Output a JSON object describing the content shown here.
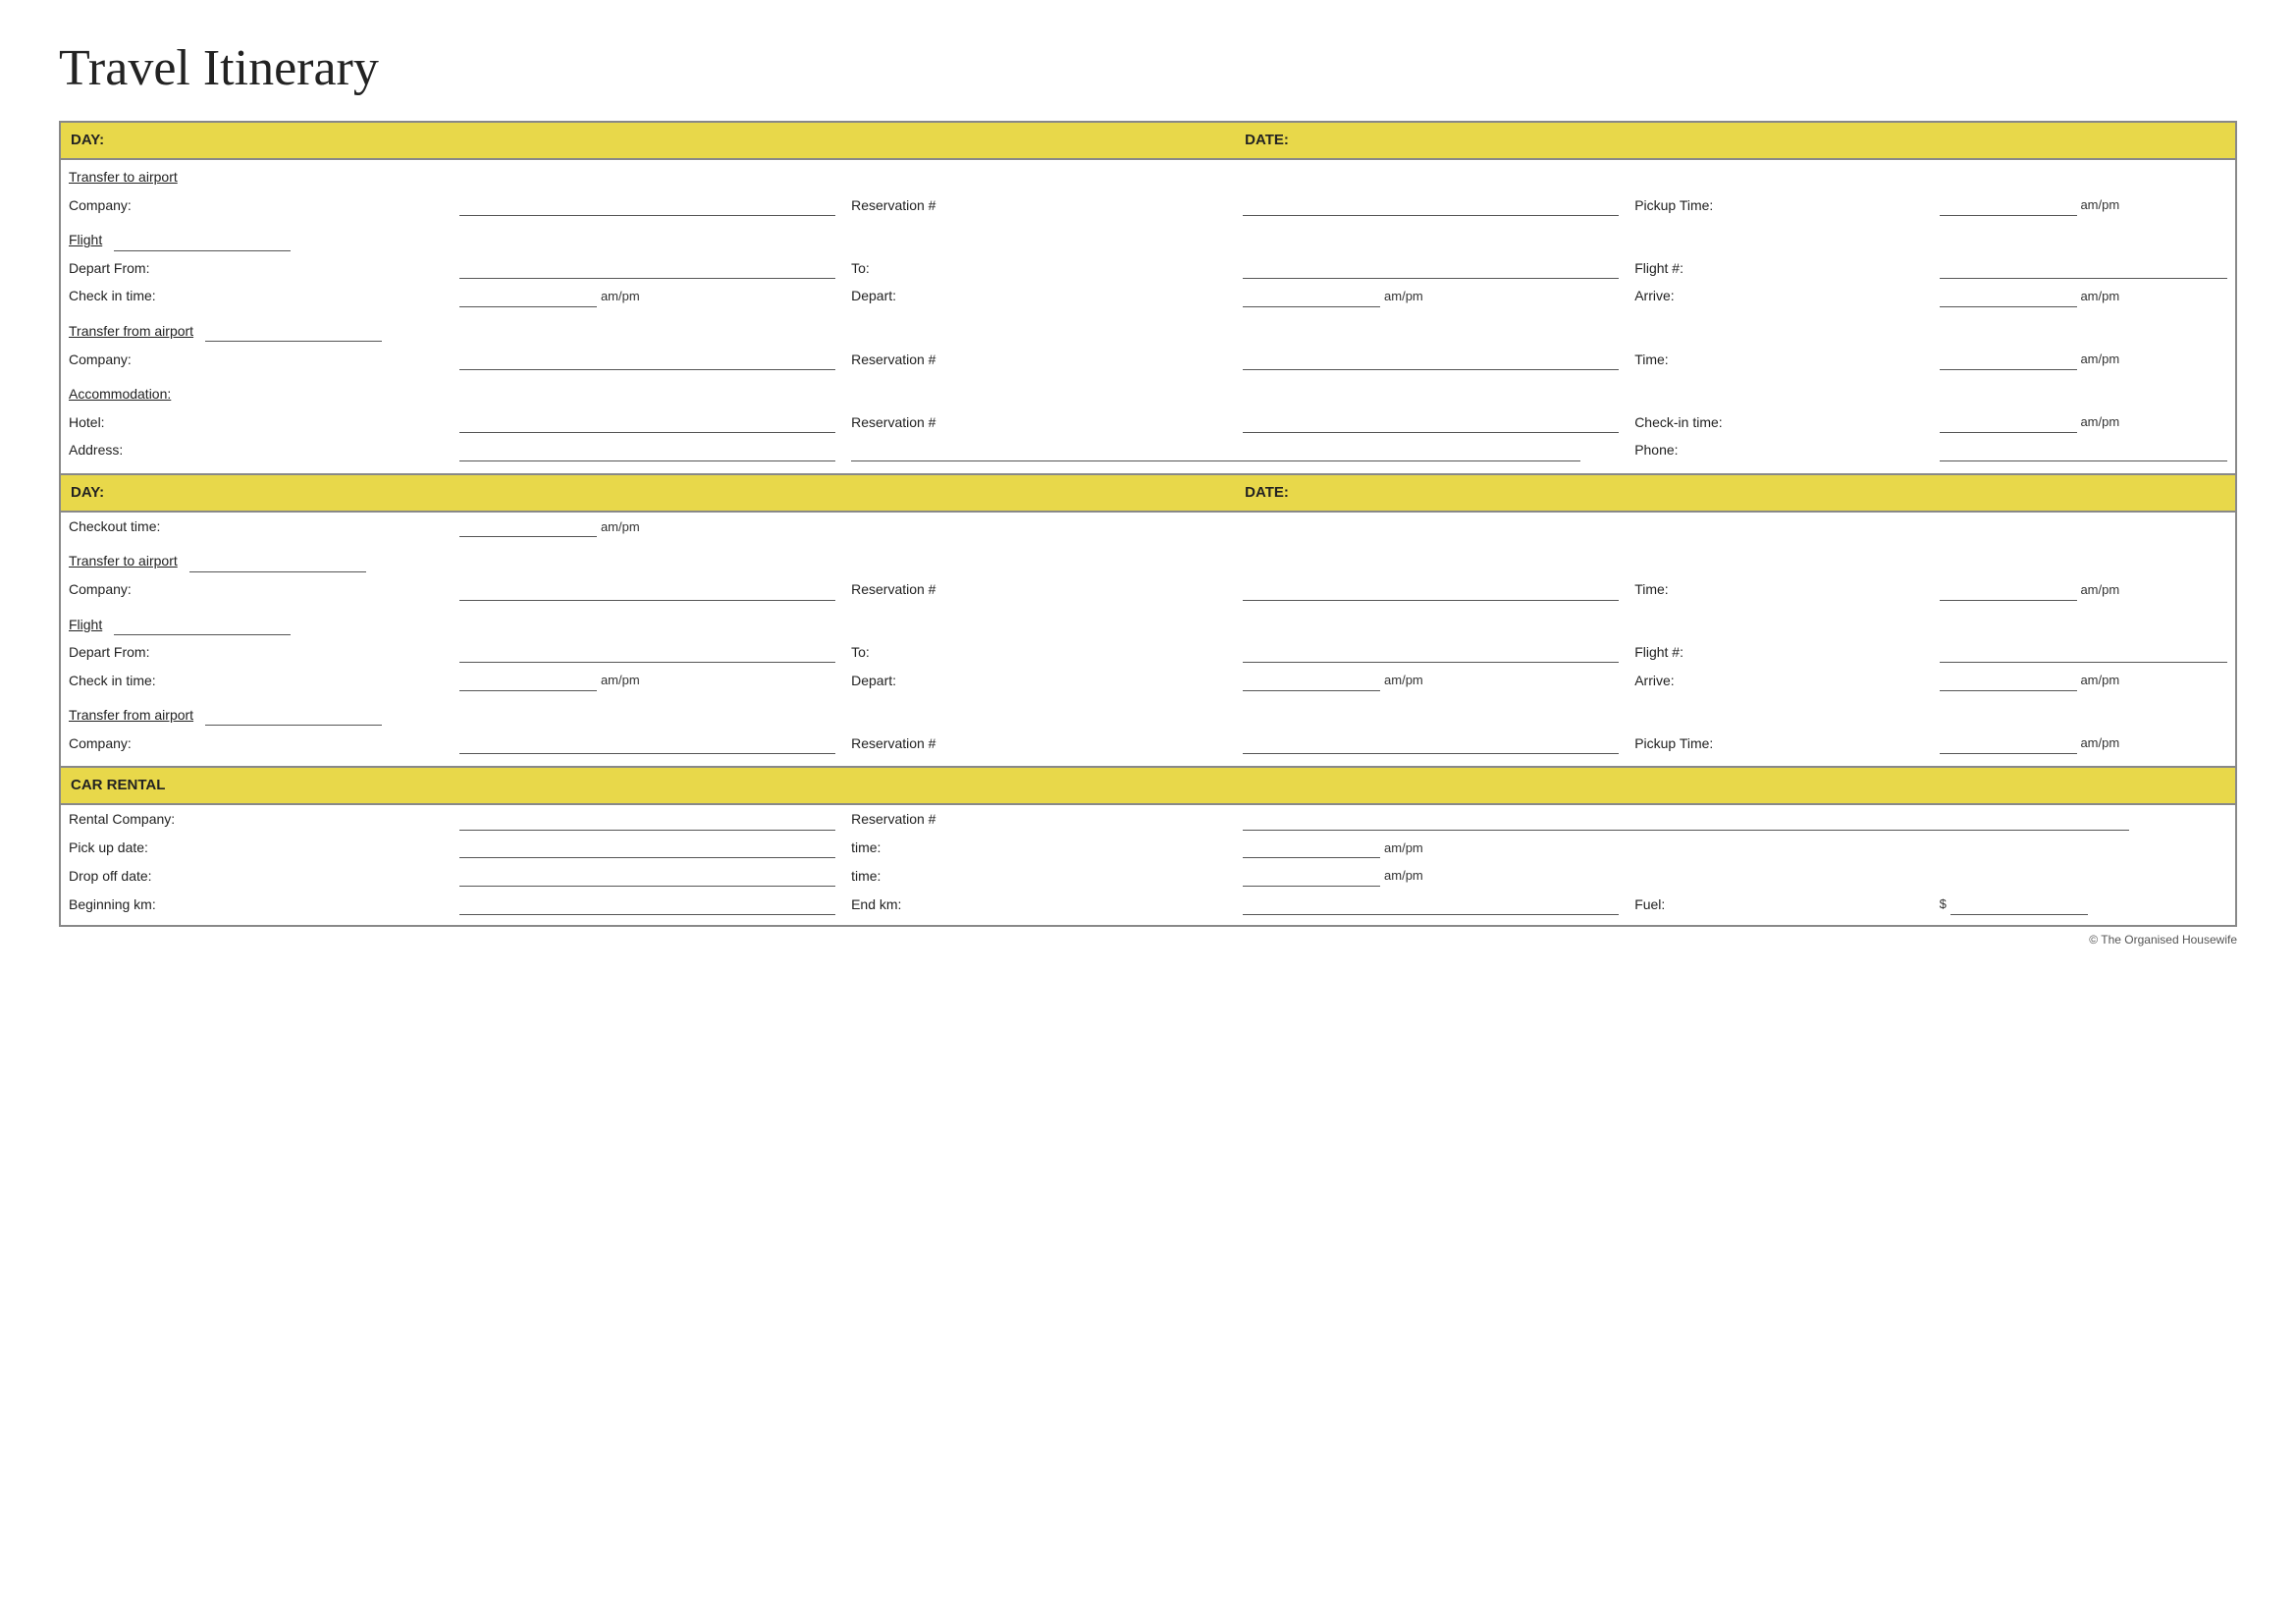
{
  "title": "Travel Itinerary",
  "day1": {
    "day_label": "DAY:",
    "date_label": "DATE:",
    "transfer_to_airport": {
      "section_title": "Transfer to airport",
      "company_label": "Company:",
      "reservation_label": "Reservation #",
      "pickup_time_label": "Pickup Time:",
      "ampm": "am/pm"
    },
    "flight": {
      "section_title": "Flight",
      "depart_from_label": "Depart From:",
      "to_label": "To:",
      "flight_num_label": "Flight #:",
      "check_in_label": "Check in time:",
      "ampm1": "am/pm",
      "depart_label": "Depart:",
      "ampm2": "am/pm",
      "arrive_label": "Arrive:",
      "ampm3": "am/pm"
    },
    "transfer_from_airport": {
      "section_title": "Transfer from airport",
      "company_label": "Company:",
      "reservation_label": "Reservation #",
      "time_label": "Time:",
      "ampm": "am/pm"
    },
    "accommodation": {
      "section_title": "Accommodation:",
      "hotel_label": "Hotel:",
      "reservation_label": "Reservation #",
      "checkin_label": "Check-in time:",
      "ampm": "am/pm",
      "address_label": "Address:",
      "phone_label": "Phone:"
    }
  },
  "day2": {
    "day_label": "DAY:",
    "date_label": "DATE:",
    "checkout": {
      "label": "Checkout time:",
      "ampm": "am/pm"
    },
    "transfer_to_airport": {
      "section_title": "Transfer to airport",
      "company_label": "Company:",
      "reservation_label": "Reservation #",
      "time_label": "Time:",
      "ampm": "am/pm"
    },
    "flight": {
      "section_title": "Flight",
      "depart_from_label": "Depart From:",
      "to_label": "To:",
      "flight_num_label": "Flight #:",
      "check_in_label": "Check in time:",
      "ampm1": "am/pm",
      "depart_label": "Depart:",
      "ampm2": "am/pm",
      "arrive_label": "Arrive:",
      "ampm3": "am/pm"
    },
    "transfer_from_airport": {
      "section_title": "Transfer from airport",
      "company_label": "Company:",
      "reservation_label": "Reservation #",
      "pickup_time_label": "Pickup Time:",
      "ampm": "am/pm"
    }
  },
  "car_rental": {
    "section_title": "CAR RENTAL",
    "rental_company_label": "Rental Company:",
    "reservation_label": "Reservation #",
    "pickup_date_label": "Pick up date:",
    "time_label1": "time:",
    "ampm1": "am/pm",
    "dropoff_date_label": "Drop off date:",
    "time_label2": "time:",
    "ampm2": "am/pm",
    "beginning_km_label": "Beginning km:",
    "end_km_label": "End km:",
    "fuel_label": "Fuel:",
    "dollar": "$"
  },
  "copyright": "© The Organised Housewife"
}
